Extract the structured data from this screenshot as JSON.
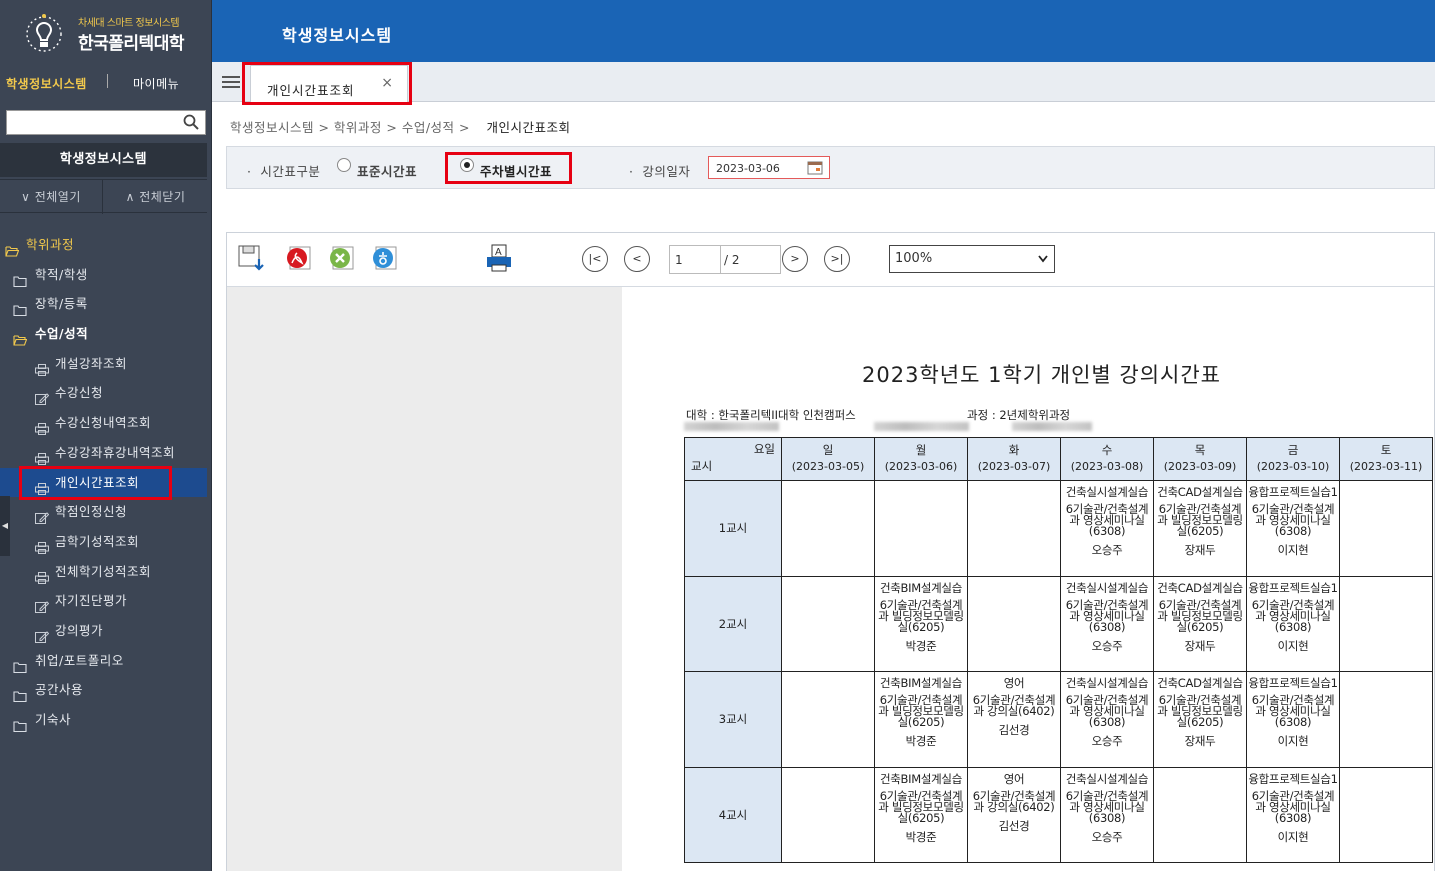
{
  "logo": {
    "sub": "차세대 스마트 정보시스템",
    "main": "한국폴리텍대학"
  },
  "topmenu": {
    "system": "학생정보시스템",
    "mymenu": "마이메뉴"
  },
  "search": {
    "placeholder": ""
  },
  "sidebar": {
    "sysbar": "학생정보시스템",
    "expand_all": "전체열기",
    "collapse_all": "전체닫기",
    "tree": [
      {
        "label": "학위과정",
        "level": 0,
        "icon": "folder-open-icon"
      },
      {
        "label": "학적/학생",
        "level": 1,
        "icon": "folder-icon"
      },
      {
        "label": "장학/등록",
        "level": 1,
        "icon": "folder-icon"
      },
      {
        "label": "수업/성적",
        "level": 1,
        "icon": "folder-open-icon"
      },
      {
        "label": "개설강좌조회",
        "level": 2,
        "icon": "print-icon"
      },
      {
        "label": "수강신청",
        "level": 2,
        "icon": "edit-icon"
      },
      {
        "label": "수강신청내역조회",
        "level": 2,
        "icon": "print-icon"
      },
      {
        "label": "수강강좌휴강내역조회",
        "level": 2,
        "icon": "print-icon"
      },
      {
        "label": "개인시간표조회",
        "level": 2,
        "icon": "print-icon",
        "active": true
      },
      {
        "label": "학점인정신청",
        "level": 2,
        "icon": "edit-icon"
      },
      {
        "label": "금학기성적조회",
        "level": 2,
        "icon": "print-icon"
      },
      {
        "label": "전체학기성적조회",
        "level": 2,
        "icon": "print-icon"
      },
      {
        "label": "자기진단평가",
        "level": 2,
        "icon": "edit-icon"
      },
      {
        "label": "강의평가",
        "level": 2,
        "icon": "edit-icon"
      },
      {
        "label": "취업/포트폴리오",
        "level": 1,
        "icon": "folder-icon"
      },
      {
        "label": "공간사용",
        "level": 1,
        "icon": "folder-icon"
      },
      {
        "label": "기숙사",
        "level": 1,
        "icon": "folder-icon"
      }
    ]
  },
  "header": {
    "title": "학생정보시스템"
  },
  "tab": {
    "label": "개인시간표조회",
    "close": "×"
  },
  "breadcrumb": {
    "path": "학생정보시스템 > 학위과정 > 수업/성적 > ",
    "current": "개인시간표조회"
  },
  "searchpanel": {
    "type_label": "시간표구분",
    "option_standard": "표준시간표",
    "option_weekly": "주차별시간표",
    "selected": "주차별시간표",
    "date_label": "강의일자",
    "date_value": "2023-03-06"
  },
  "viewer": {
    "page": "1",
    "total": "/ 2",
    "zoom": "100%",
    "nav": {
      "first": "|<",
      "prev": "<",
      "next": ">",
      "last": ">|"
    }
  },
  "report": {
    "title": "2023학년도  1학기  개인별  강의시간표",
    "college": "대학 : 한국폴리텍II대학  인천캠퍼스",
    "course": "과정 : 2년제학위과정",
    "header_day": "요일",
    "header_period": "교시",
    "days": [
      {
        "day": "일",
        "date": "(2023-03-05)"
      },
      {
        "day": "월",
        "date": "(2023-03-06)"
      },
      {
        "day": "화",
        "date": "(2023-03-07)"
      },
      {
        "day": "수",
        "date": "(2023-03-08)"
      },
      {
        "day": "목",
        "date": "(2023-03-09)"
      },
      {
        "day": "금",
        "date": "(2023-03-10)"
      },
      {
        "day": "토",
        "date": "(2023-03-11)"
      }
    ],
    "periods": [
      {
        "label": "1교시",
        "cells": [
          null,
          null,
          null,
          {
            "name": "건축실시설계실습",
            "room": "6기술관/건축설계과 영상세미나실(6308)",
            "prof": "오승주"
          },
          {
            "name": "건축CAD설계실습",
            "room": "6기술관/건축설계과 빌딩정보모델링실(6205)",
            "prof": "장재두"
          },
          {
            "name": "융합프로젝트실습1",
            "room": "6기술관/건축설계과 영상세미나실(6308)",
            "prof": "이지현"
          },
          null
        ]
      },
      {
        "label": "2교시",
        "cells": [
          null,
          {
            "name": "건축BIM설계실습",
            "room": "6기술관/건축설계과 빌딩정보모델링실(6205)",
            "prof": "박경준"
          },
          null,
          {
            "name": "건축실시설계실습",
            "room": "6기술관/건축설계과 영상세미나실(6308)",
            "prof": "오승주"
          },
          {
            "name": "건축CAD설계실습",
            "room": "6기술관/건축설계과 빌딩정보모델링실(6205)",
            "prof": "장재두"
          },
          {
            "name": "융합프로젝트실습1",
            "room": "6기술관/건축설계과 영상세미나실(6308)",
            "prof": "이지현"
          },
          null
        ]
      },
      {
        "label": "3교시",
        "cells": [
          null,
          {
            "name": "건축BIM설계실습",
            "room": "6기술관/건축설계과 빌딩정보모델링실(6205)",
            "prof": "박경준"
          },
          {
            "name": "영어",
            "room": "6기술관/건축설계과 강의실(6402)",
            "prof": "김선경"
          },
          {
            "name": "건축실시설계실습",
            "room": "6기술관/건축설계과 영상세미나실(6308)",
            "prof": "오승주"
          },
          {
            "name": "건축CAD설계실습",
            "room": "6기술관/건축설계과 빌딩정보모델링실(6205)",
            "prof": "장재두"
          },
          {
            "name": "융합프로젝트실습1",
            "room": "6기술관/건축설계과 영상세미나실(6308)",
            "prof": "이지현"
          },
          null
        ]
      },
      {
        "label": "4교시",
        "cells": [
          null,
          {
            "name": "건축BIM설계실습",
            "room": "6기술관/건축설계과 빌딩정보모델링실(6205)",
            "prof": "박경준"
          },
          {
            "name": "영어",
            "room": "6기술관/건축설계과 강의실(6402)",
            "prof": "김선경"
          },
          {
            "name": "건축실시설계실습",
            "room": "6기술관/건축설계과 영상세미나실(6308)",
            "prof": "오승주"
          },
          null,
          {
            "name": "융합프로젝트실습1",
            "room": "6기술관/건축설계과 영상세미나실(6308)",
            "prof": "이지현"
          },
          null
        ]
      }
    ]
  },
  "colors": {
    "header": "#1a64b5",
    "sidebar": "#3c4554",
    "active": "#1d4b8f",
    "highlight": "#e60012",
    "table_header": "#dce7f3"
  }
}
